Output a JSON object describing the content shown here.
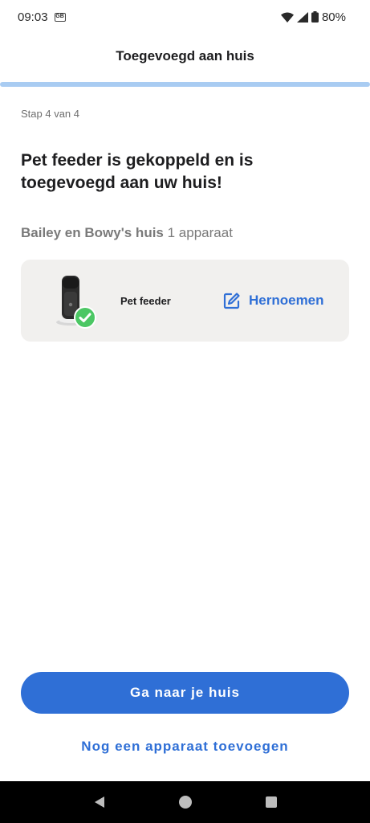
{
  "status_bar": {
    "time": "09:03",
    "notification_badge": "GB",
    "battery_percent": "80%",
    "icons": [
      "wifi-icon",
      "cell-signal-icon",
      "battery-icon"
    ]
  },
  "header": {
    "title": "Toegevoegd aan huis",
    "progress": 1.0
  },
  "step_label": "Stap 4 van 4",
  "headline": "Pet feeder is gekoppeld en is toegevoegd aan uw huis!",
  "home": {
    "name": "Bailey en Bowy's huis",
    "count": "1 apparaat"
  },
  "device": {
    "name": "Pet feeder",
    "rename_label": "Hernoemen",
    "status_icon": "check-circle-icon"
  },
  "actions": {
    "primary_label": "Ga naar je huis",
    "secondary_label": "Nog een apparaat toevoegen"
  },
  "colors": {
    "accent": "#2f6fd6",
    "progress": "#a9ccf2",
    "card_bg": "#f1f0ee",
    "success": "#4cc764"
  }
}
